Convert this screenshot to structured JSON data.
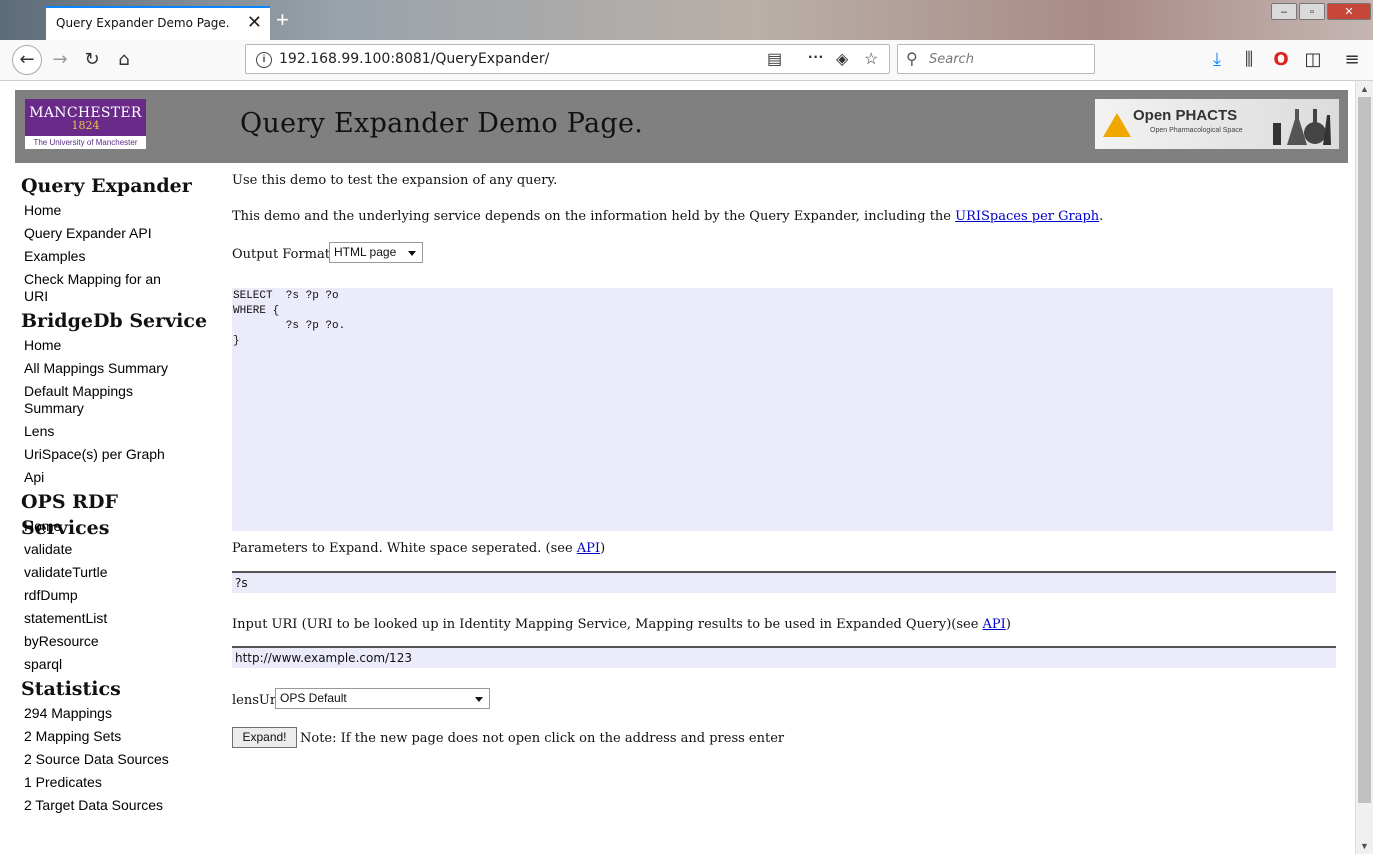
{
  "browser": {
    "tab_title": "Query Expander Demo Page.",
    "tab_close": "✕",
    "new_tab": "+",
    "url": "192.168.99.100:8081/QueryExpander/",
    "search_placeholder": "Search",
    "window_buttons": {
      "minimize": "‒",
      "maximize": "▫",
      "close": "✕"
    },
    "icons": [
      "back-arrow-icon",
      "forward-arrow-icon",
      "reload-icon",
      "home-icon",
      "info-icon",
      "reader-view-icon",
      "page-actions-icon",
      "pocket-icon",
      "bookmark-star-icon",
      "search-icon",
      "download-icon",
      "library-icon",
      "opera-icon",
      "sidebar-icon",
      "menu-icon"
    ],
    "accent_color": "#0a84ff"
  },
  "header": {
    "title": "Query Expander Demo Page.",
    "left_logo": {
      "name": "MANCHESTER",
      "year": "1824",
      "subtitle": "The University of Manchester"
    },
    "right_logo": {
      "name": "Open PHACTS",
      "subtitle": "Open Pharmacological Space"
    },
    "bg_color": "#808080"
  },
  "sidebar": {
    "sections": [
      {
        "heading": "Query Expander",
        "items": [
          "Home",
          "Query Expander API",
          "Examples",
          "Check Mapping for an URI"
        ]
      },
      {
        "heading": "BridgeDb Service",
        "items": [
          "Home",
          "All Mappings Summary",
          "Default Mappings Summary",
          "Lens",
          "UriSpace(s) per Graph",
          "Api"
        ]
      },
      {
        "heading": "OPS RDF Services",
        "items": [
          "Home",
          "validate",
          "validateTurtle",
          "rdfDump",
          "statementList",
          "byResource",
          "sparql"
        ]
      },
      {
        "heading": "Statistics",
        "items": [
          "294 Mappings",
          "2 Mapping Sets",
          "2 Source Data Sources",
          "1 Predicates",
          "2 Target Data Sources"
        ]
      }
    ]
  },
  "main": {
    "intro": "Use this demo to test the expansion of any query.",
    "depends_prefix": "This demo and the underlying service depends on the information held by the Query Expander, including the ",
    "depends_link": "URISpaces per Graph",
    "depends_suffix": ".",
    "output_format_label": "Output Format:",
    "output_format_value": "HTML page",
    "query_text": "SELECT  ?s ?p ?o\nWHERE {\n        ?s ?p ?o.\n}",
    "params_label": "Parameters to Expand. White space seperated. (see ",
    "params_link": "API",
    "params_suffix": ")",
    "params_value": "?s",
    "input_uri_label": "Input URI (URI to be looked up in Identity Mapping Service, Mapping results to be used in Expanded Query)(see ",
    "input_uri_link": "API",
    "input_uri_suffix": ")",
    "input_uri_value": "http://www.example.com/123",
    "lens_label": "lensUri",
    "lens_value": "OPS Default",
    "expand_button": "Expand!",
    "note": "Note: If the new page does not open click on the address and press enter"
  }
}
